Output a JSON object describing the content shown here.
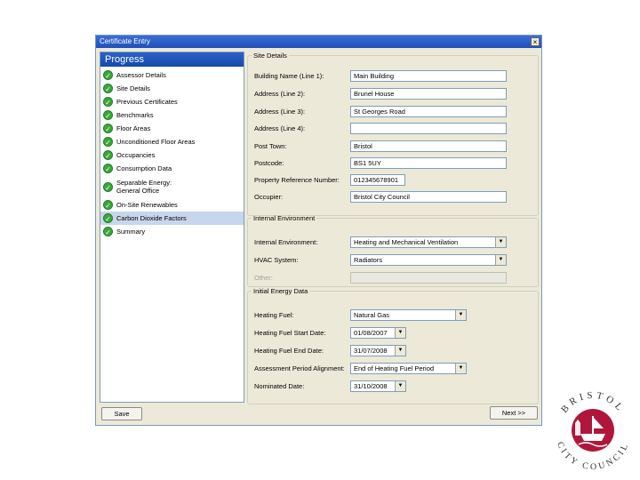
{
  "window": {
    "title": "Certificate Entry",
    "close_glyph": "×"
  },
  "progress": {
    "header": "Progress",
    "items": [
      {
        "label": "Assessor Details"
      },
      {
        "label": "Site Details"
      },
      {
        "label": "Previous Certificates"
      },
      {
        "label": "Benchmarks"
      },
      {
        "label": "Floor Areas"
      },
      {
        "label": "Unconditioned Floor Areas"
      },
      {
        "label": "Occupancies"
      },
      {
        "label": "Consumption Data"
      },
      {
        "label": "Separable Energy: General Office"
      },
      {
        "label": "On-Site Renewables"
      },
      {
        "label": "Carbon Dioxide Factors"
      },
      {
        "label": "Summary"
      }
    ],
    "selected_index": 10,
    "check_glyph": "✓"
  },
  "site_details": {
    "legend": "Site Details",
    "building_name": {
      "label": "Building Name (Line 1):",
      "value": "Main Building"
    },
    "address2": {
      "label": "Address (Line 2):",
      "value": "Brunel House"
    },
    "address3": {
      "label": "Address (Line 3):",
      "value": "St Georges Road"
    },
    "address4": {
      "label": "Address (Line 4):",
      "value": ""
    },
    "post_town": {
      "label": "Post Town:",
      "value": "Bristol"
    },
    "postcode": {
      "label": "Postcode:",
      "value": "BS1 5UY"
    },
    "property_ref": {
      "label": "Property Reference Number:",
      "value": "012345678901"
    },
    "occupier": {
      "label": "Occupier:",
      "value": "Bristol City Council"
    }
  },
  "internal_environment": {
    "legend": "Internal Environment",
    "environment": {
      "label": "Internal Environment:",
      "value": "Heating and Mechanical Ventilation"
    },
    "hvac": {
      "label": "HVAC System:",
      "value": "Radiators"
    },
    "other": {
      "label": "Other:",
      "value": ""
    }
  },
  "energy_data": {
    "legend": "Initial Energy Data",
    "heating_fuel": {
      "label": "Heating Fuel:",
      "value": "Natural Gas"
    },
    "start_date": {
      "label": "Heating Fuel Start Date:",
      "value": "01/08/2007"
    },
    "end_date": {
      "label": "Heating Fuel End Date:",
      "value": "31/07/2008"
    },
    "alignment": {
      "label": "Assessment Period Alignment:",
      "value": "End of Heating Fuel Period"
    },
    "nominated_date": {
      "label": "Nominated Date:",
      "value": "31/10/2008"
    }
  },
  "buttons": {
    "save": "Save",
    "next": "Next >>"
  },
  "logo": {
    "text_top": "BRISTOL",
    "text_bottom": "CITY COUNCIL",
    "color": "#b0163c"
  },
  "colors": {
    "title_bar": "#1f4fb8",
    "selected_item": "#c8d6ec",
    "check": "#3aa83a"
  }
}
